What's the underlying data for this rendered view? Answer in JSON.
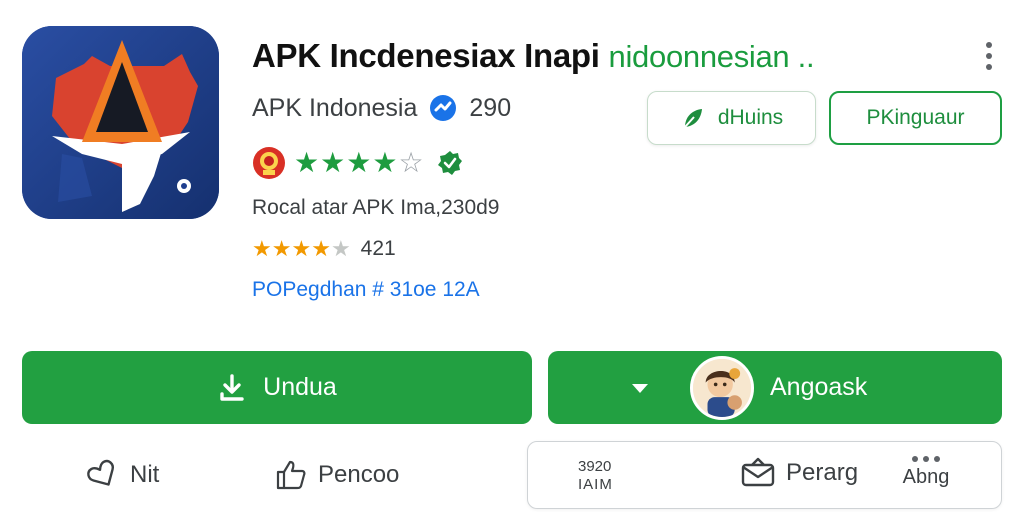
{
  "app": {
    "title_main": "APK Incdenesiax Inapi",
    "title_accent": "nidoonnesian ..",
    "developer": "APK Indonesia",
    "developer_count": "290",
    "meta_line": "Rocal atar APK Ima,230d9",
    "rating_count": "421",
    "link_line": "POPegdhan # 31oe 12A"
  },
  "chips": {
    "first": "dHuins",
    "second": "PKinguaur"
  },
  "ratings": {
    "green_stars_value": 3.5,
    "orange_stars_value": 4
  },
  "buttons": {
    "download": "Undua",
    "angoask": "Angoask"
  },
  "actions": {
    "nit": "Nit",
    "pencoo": "Pencoo"
  },
  "stats": {
    "top": "3920",
    "bottom": "IAIM",
    "share": "Perarg",
    "more": "Abng"
  },
  "colors": {
    "accent_green": "#22a041",
    "title_green": "#1a9c3e",
    "link_blue": "#1a73e8",
    "icon_blue": "#1f3f8f",
    "icon_orange": "#f07d23",
    "icon_red": "#d9432f"
  },
  "icons": {
    "download": "download-arrow-icon",
    "caret": "caret-down-icon",
    "nit": "heart-outline-icon",
    "pencoo": "thumbs-up-icon",
    "share": "envelope-icon",
    "more": "three-dots-icon",
    "verified": "verified-check-icon",
    "developer_badge": "verified-badge-icon"
  }
}
